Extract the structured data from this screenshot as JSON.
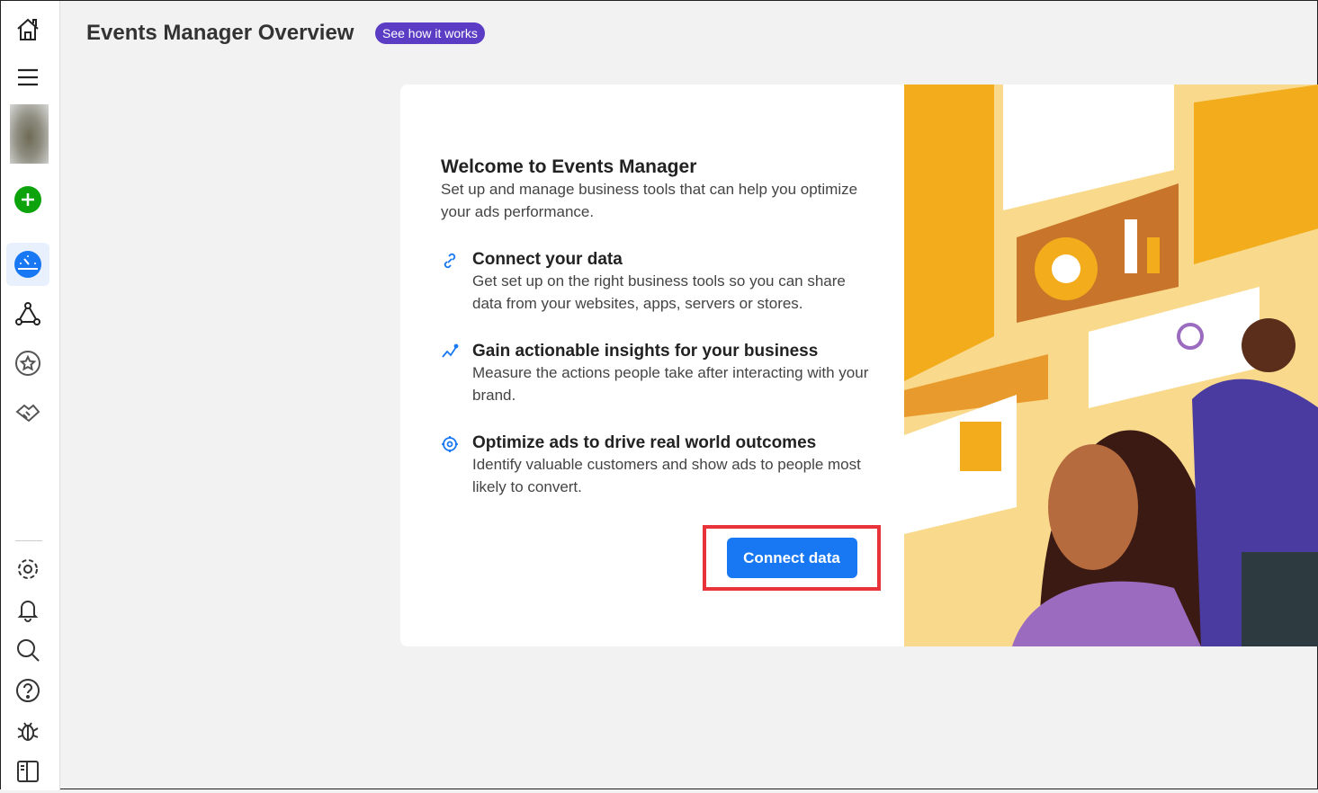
{
  "sidebar": {
    "items": [
      {
        "icon": "home-icon"
      },
      {
        "icon": "menu-icon"
      },
      {
        "icon": "add-icon"
      },
      {
        "icon": "dashboard-icon",
        "active": true
      },
      {
        "icon": "graph-icon"
      },
      {
        "icon": "star-icon"
      },
      {
        "icon": "handshake-icon"
      }
    ],
    "bottom": [
      {
        "icon": "gear-icon"
      },
      {
        "icon": "bell-icon"
      },
      {
        "icon": "search-icon"
      },
      {
        "icon": "help-icon"
      },
      {
        "icon": "bug-icon"
      },
      {
        "icon": "panel-icon"
      }
    ]
  },
  "header": {
    "title": "Events Manager Overview",
    "help_pill": "See how it works"
  },
  "welcome": {
    "title": "Welcome to Events Manager",
    "subtitle": "Set up and manage business tools that can help you optimize your ads performance.",
    "items": [
      {
        "icon": "link-icon",
        "title": "Connect your data",
        "text": "Get set up on the right business tools so you can share data from your websites, apps, servers or stores."
      },
      {
        "icon": "insights-icon",
        "title": "Gain actionable insights for your business",
        "text": "Measure the actions people take after interacting with your brand."
      },
      {
        "icon": "target-icon",
        "title": "Optimize ads to drive real world outcomes",
        "text": "Identify valuable customers and show ads to people most likely to convert."
      }
    ],
    "button": "Connect data"
  },
  "colors": {
    "accent": "#1877f2",
    "pill": "#5b3cc4",
    "highlight": "#e8333a",
    "add": "#0ca30c"
  }
}
